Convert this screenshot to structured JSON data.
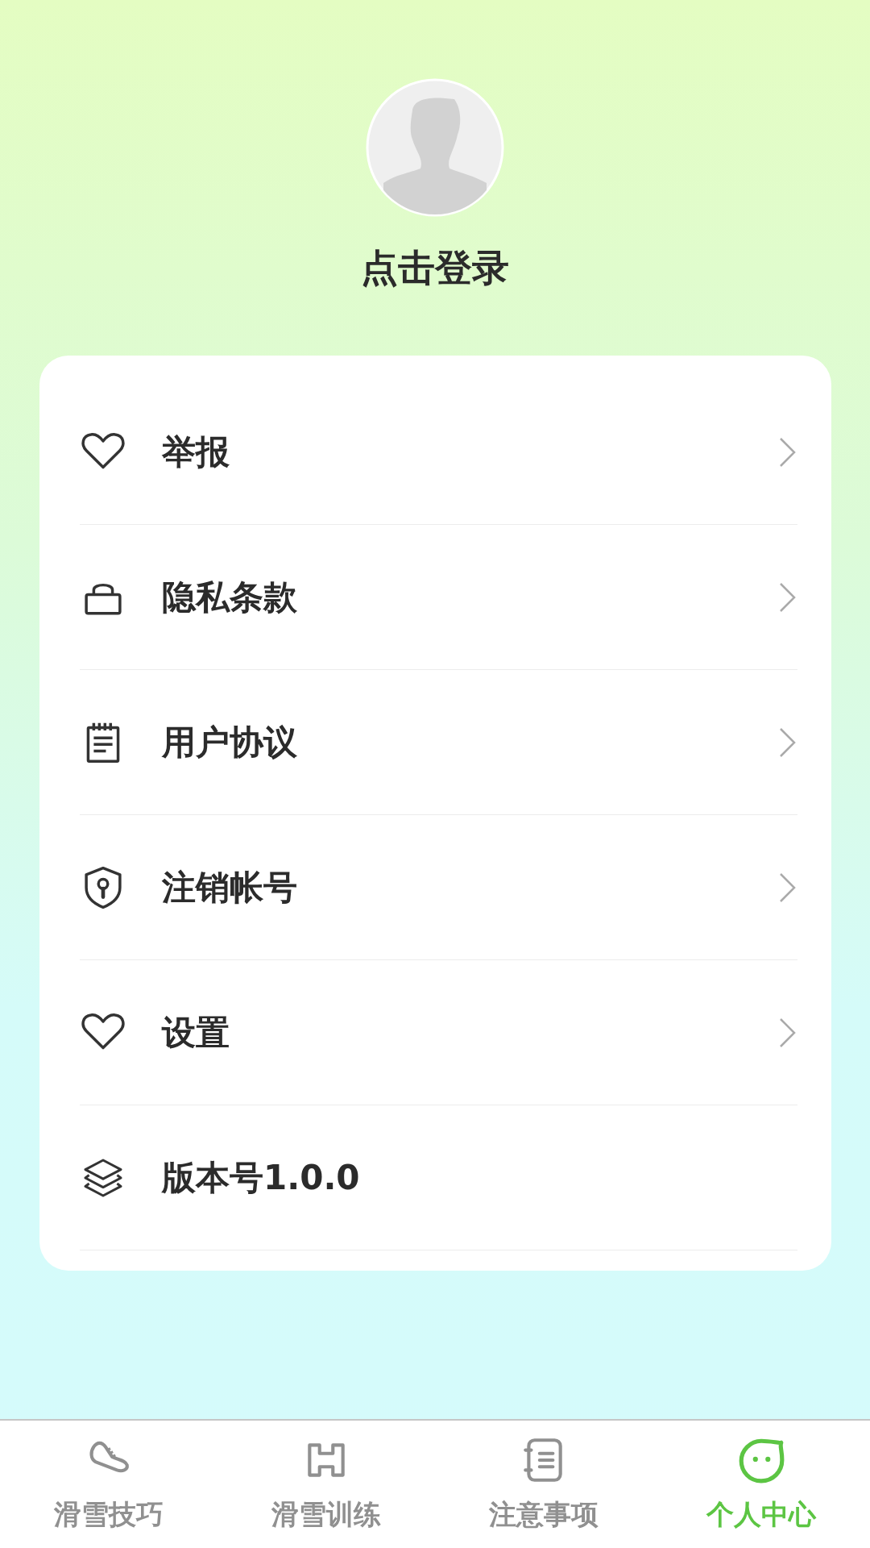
{
  "profile": {
    "login_label": "点击登录"
  },
  "menu": [
    {
      "label": "举报",
      "chevron": true
    },
    {
      "label": "隐私条款",
      "chevron": true
    },
    {
      "label": "用户协议",
      "chevron": true
    },
    {
      "label": "注销帐号",
      "chevron": true
    },
    {
      "label": "设置",
      "chevron": true
    },
    {
      "label": "版本号1.0.0",
      "chevron": false
    }
  ],
  "tab_bar": [
    {
      "label": "滑雪技巧",
      "selected": false
    },
    {
      "label": "滑雪训练",
      "selected": false
    },
    {
      "label": "注意事项",
      "selected": false
    },
    {
      "label": "个人中心",
      "selected": true
    }
  ]
}
